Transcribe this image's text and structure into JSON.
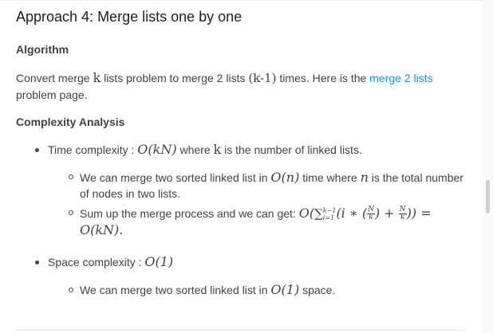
{
  "title": "Approach 4: Merge lists one by one",
  "algorithm": {
    "heading": "Algorithm",
    "text_before": "Convert merge",
    "k": "k",
    "text_mid": "lists problem to merge 2 lists",
    "k_minus_1": "(k-1)",
    "text_after": "times. Here is the",
    "link": "merge 2 lists",
    "text_end": "problem page."
  },
  "complexity": {
    "heading": "Complexity Analysis",
    "time": {
      "label": "Time complexity :",
      "expr": "O(kN)",
      "suffix_1": "where",
      "k": "k",
      "suffix_2": "is the number of linked lists.",
      "sub1_a": "We can merge two sorted linked list in",
      "sub1_expr": "O(n)",
      "sub1_b": "time where",
      "sub1_n": "n",
      "sub1_c": "is the total number",
      "sub1_d": "of nodes in two lists.",
      "sub2_a": "Sum up the merge process and we can get:",
      "sub2_result": "O(kN)."
    },
    "space": {
      "label": "Space complexity :",
      "expr": "O(1)",
      "sub1_a": "We can merge two sorted linked list in",
      "sub1_expr": "O(1)",
      "sub1_b": "space."
    }
  }
}
